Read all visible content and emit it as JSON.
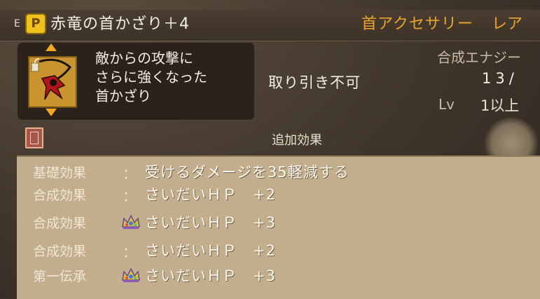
{
  "header": {
    "e_mark": "E",
    "gold_icon_glyph": "P",
    "item_name": "赤竜の首かざり＋4",
    "category": "首アクセサリー",
    "rarity": "レア"
  },
  "item": {
    "icon": "red-dragon-necklace-icon",
    "description": [
      "敵からの攻撃に",
      "さらに強くなった",
      "首かざり"
    ],
    "tradable_status": "取り引き不可"
  },
  "synthesis": {
    "energy_label": "合成エナジー",
    "energy_value": "13/",
    "lv_label": "Lv",
    "lv_value": "1以上"
  },
  "effects": {
    "header": "追加効果",
    "rows": [
      {
        "label": "基礎効果",
        "separator": "：",
        "value": "受けるダメージを35軽減する",
        "crown": false
      },
      {
        "label": "合成効果",
        "separator": "：",
        "value": "さいだいＨＰ　+2",
        "crown": false
      },
      {
        "label": "合成効果",
        "separator": "",
        "value": "さいだいＨＰ　+3",
        "crown": true
      },
      {
        "label": "合成効果",
        "separator": "：",
        "value": "さいだいＨＰ　+2",
        "crown": false
      },
      {
        "label": "第一伝承",
        "separator": "",
        "value": "さいだいＨＰ　+3",
        "crown": true
      }
    ]
  },
  "colors": {
    "accent_orange": "#e9a52c",
    "panel_parchment": "#c2ad8c",
    "dark_panel": "#2a221b"
  }
}
